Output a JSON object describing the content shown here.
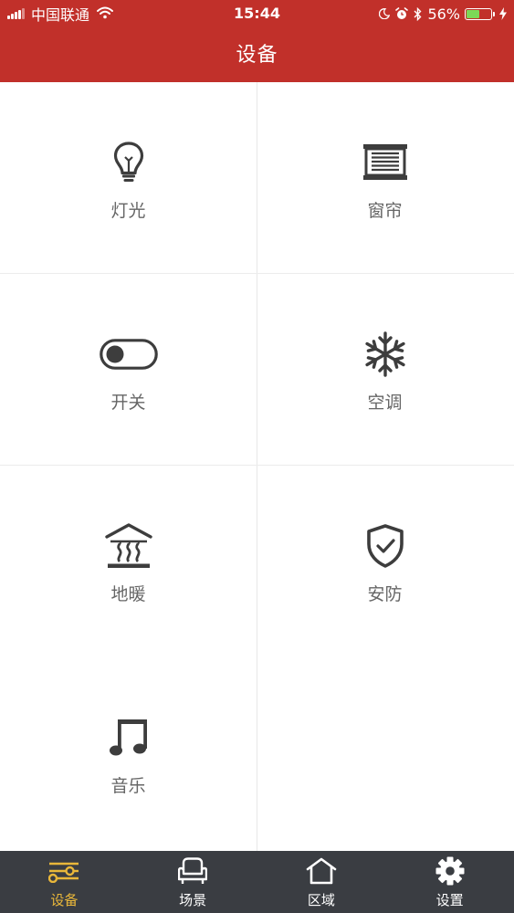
{
  "status_bar": {
    "carrier": "中国联通",
    "time": "15:44",
    "battery": "56%",
    "battery_level": 0.56
  },
  "header": {
    "title": "设备"
  },
  "devices": [
    {
      "label": "灯光",
      "icon": "lightbulb-icon"
    },
    {
      "label": "窗帘",
      "icon": "curtain-icon"
    },
    {
      "label": "开关",
      "icon": "toggle-switch-icon"
    },
    {
      "label": "空调",
      "icon": "snowflake-icon"
    },
    {
      "label": "地暖",
      "icon": "floor-heating-icon"
    },
    {
      "label": "安防",
      "icon": "shield-check-icon"
    },
    {
      "label": "音乐",
      "icon": "music-note-icon"
    }
  ],
  "tabbar": {
    "active_index": 0,
    "active_color": "#e9b73a",
    "items": [
      {
        "label": "设备",
        "icon": "sliders-icon"
      },
      {
        "label": "场景",
        "icon": "armchair-icon"
      },
      {
        "label": "区域",
        "icon": "house-icon"
      },
      {
        "label": "设置",
        "icon": "gear-icon"
      }
    ]
  },
  "colors": {
    "header_bg": "#c1302a",
    "tabbar_bg": "#3a3d42",
    "icon": "#3d3d3d",
    "label": "#666666"
  }
}
